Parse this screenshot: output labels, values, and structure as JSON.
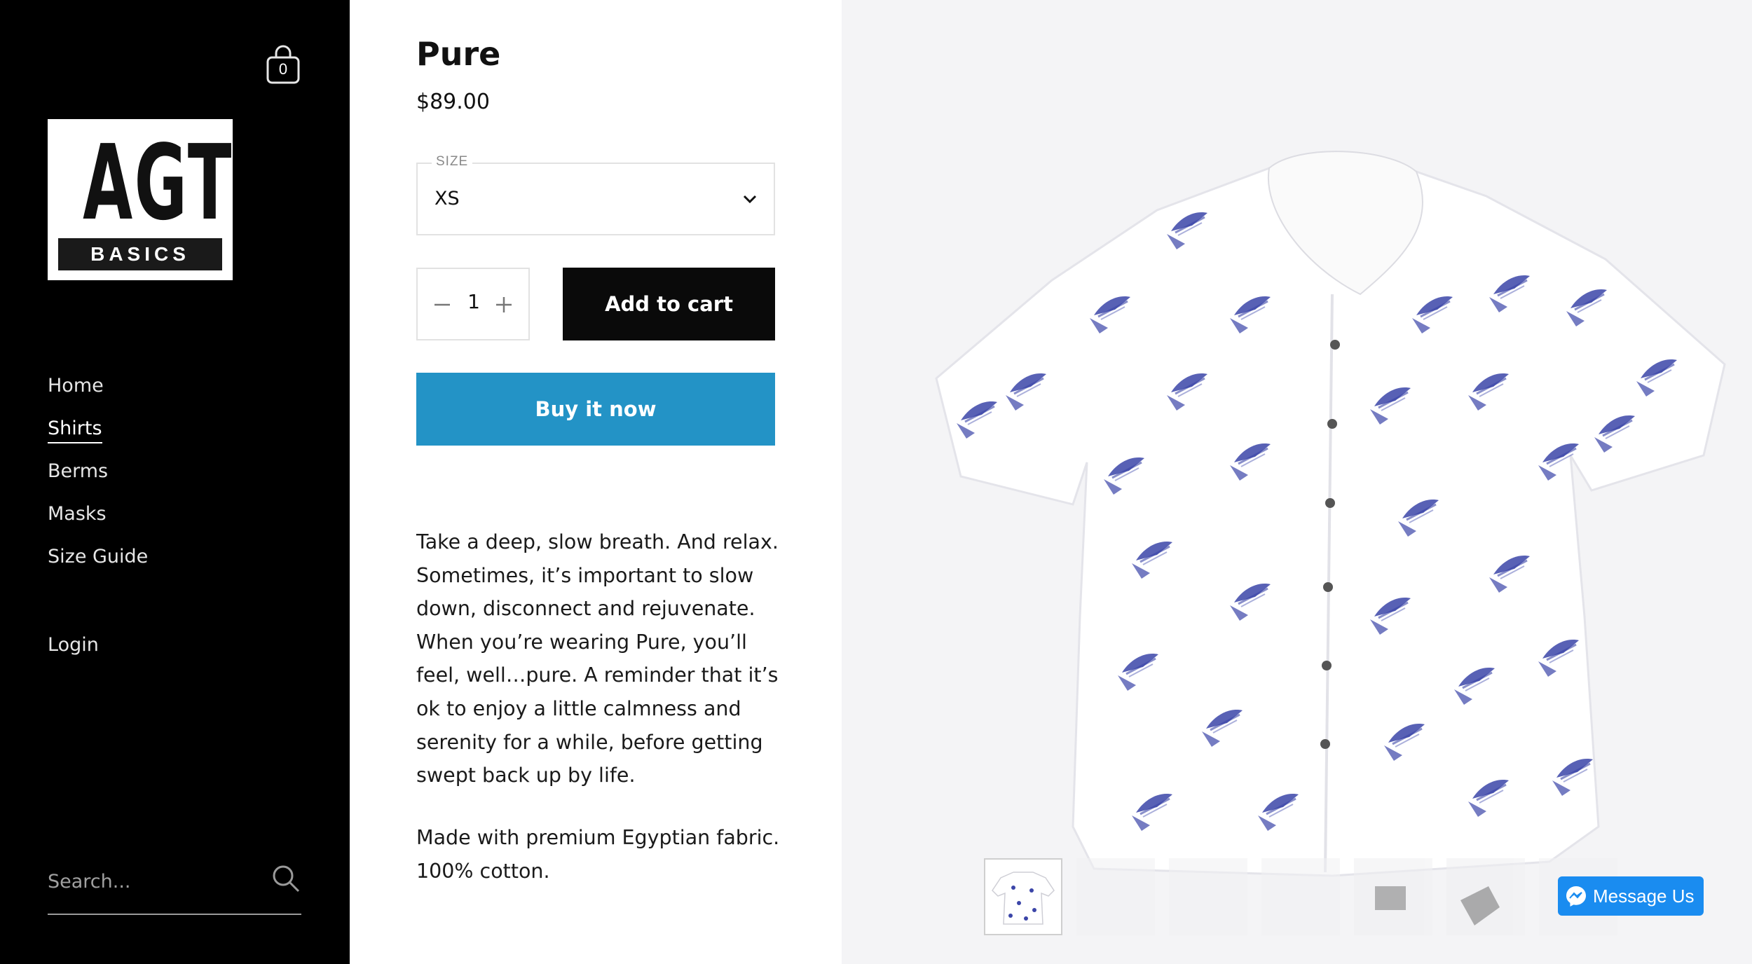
{
  "sidebar": {
    "cart_count": "0",
    "logo": {
      "main": "AGT",
      "sub": "BASICS"
    },
    "nav": [
      {
        "label": "Home",
        "active": false
      },
      {
        "label": "Shirts",
        "active": true
      },
      {
        "label": "Berms",
        "active": false
      },
      {
        "label": "Masks",
        "active": false
      },
      {
        "label": "Size Guide",
        "active": false
      }
    ],
    "login": "Login",
    "search_placeholder": "Search..."
  },
  "product": {
    "title": "Pure",
    "price": "$89.00",
    "size_label": "SIZE",
    "size_value": "XS",
    "quantity": "1",
    "add_to_cart": "Add to cart",
    "buy_now": "Buy it now",
    "description": "Take a deep, slow breath. And relax. Sometimes, it’s important to slow down, disconnect and rejuvenate. When you’re wearing Pure, you’ll feel, well…pure. A reminder that it’s ok to enjoy a little calmness and serenity for a while, before getting swept back up by life.",
    "fabric": "Made with premium Egyptian fabric. 100% cotton."
  },
  "gallery": {
    "thumbnail_count": 7,
    "selected_index": 0
  },
  "chat": {
    "label": "Message Us"
  },
  "colors": {
    "sidebar_bg": "#000000",
    "add_cart_bg": "#0a0a0a",
    "buy_now_bg": "#2393c6",
    "messenger_bg": "#1a8cf0",
    "print_blue": "#3b45a8"
  }
}
